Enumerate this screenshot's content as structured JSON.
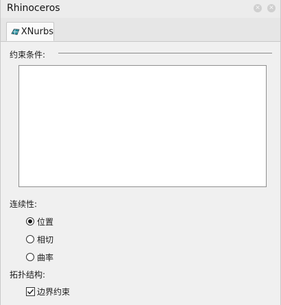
{
  "window": {
    "title": "Rhinoceros",
    "pin_glyph": "✕",
    "close_glyph": "✕"
  },
  "tabs": [
    {
      "label": "XNurbs",
      "icon": "xnurbs-surface-icon",
      "active": true
    }
  ],
  "constraints": {
    "label": "约束条件:",
    "items": []
  },
  "continuity": {
    "label": "连续性:",
    "options": [
      {
        "label": "位置",
        "selected": true
      },
      {
        "label": "相切",
        "selected": false
      },
      {
        "label": "曲率",
        "selected": false
      }
    ]
  },
  "topology": {
    "label": "拓扑结构:",
    "boundary_constraint": {
      "label": "边界约束",
      "checked": true
    }
  },
  "colors": {
    "icon_teal": "#2a8d9c",
    "icon_dark": "#3a4a50"
  }
}
